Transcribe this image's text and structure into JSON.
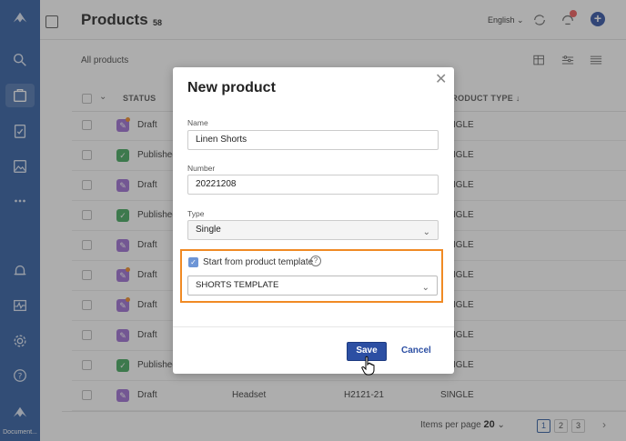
{
  "sidebar": {
    "doc_label": "Document...",
    "icons": [
      "logo-icon",
      "search-icon",
      "products-icon",
      "tasks-icon",
      "images-icon",
      "more-icon",
      "bell-icon",
      "activity-icon",
      "settings-icon",
      "help-icon",
      "brand-icon"
    ]
  },
  "header": {
    "title": "Products",
    "count": "58",
    "language": "English"
  },
  "toolbar": {
    "view_label": "All products"
  },
  "table": {
    "columns": [
      "STATUS",
      "PRODUCT TYPE"
    ],
    "rows": [
      {
        "status": "Draft",
        "kind": "draft",
        "dot": true,
        "type": "SINGLE"
      },
      {
        "status": "Published",
        "kind": "published",
        "dot": false,
        "type": "SINGLE"
      },
      {
        "status": "Draft",
        "kind": "draft",
        "dot": false,
        "type": "SINGLE"
      },
      {
        "status": "Published",
        "kind": "published",
        "dot": false,
        "type": "SINGLE"
      },
      {
        "status": "Draft",
        "kind": "draft",
        "dot": false,
        "type": "SINGLE"
      },
      {
        "status": "Draft",
        "kind": "draft",
        "dot": true,
        "type": "SINGLE"
      },
      {
        "status": "Draft",
        "kind": "draft",
        "dot": true,
        "type": "SINGLE"
      },
      {
        "status": "Draft",
        "kind": "draft",
        "dot": false,
        "type": "SINGLE"
      },
      {
        "status": "Published",
        "kind": "published",
        "dot": false,
        "type": "SINGLE"
      },
      {
        "status": "Draft",
        "kind": "draft",
        "dot": false,
        "type": "SINGLE",
        "name": "Headset",
        "number": "H2121-21"
      }
    ]
  },
  "pagination": {
    "items_per_page_label": "Items per page",
    "items_per_page_value": "20",
    "pages": [
      "1",
      "2",
      "3"
    ],
    "current_page": "1"
  },
  "modal": {
    "title": "New product",
    "name_label": "Name",
    "name_value": "Linen Shorts",
    "number_label": "Number",
    "number_value": "20221208",
    "type_label": "Type",
    "type_value": "Single",
    "template_checkbox_label": "Start from product template",
    "template_checked": true,
    "template_value": "SHORTS TEMPLATE",
    "save_label": "Save",
    "cancel_label": "Cancel"
  },
  "colors": {
    "sidebar": "#2c5aa0",
    "primary": "#2c4fa3",
    "highlight": "#f08a24",
    "draft": "#9b6bd3",
    "published": "#3fa65a"
  }
}
